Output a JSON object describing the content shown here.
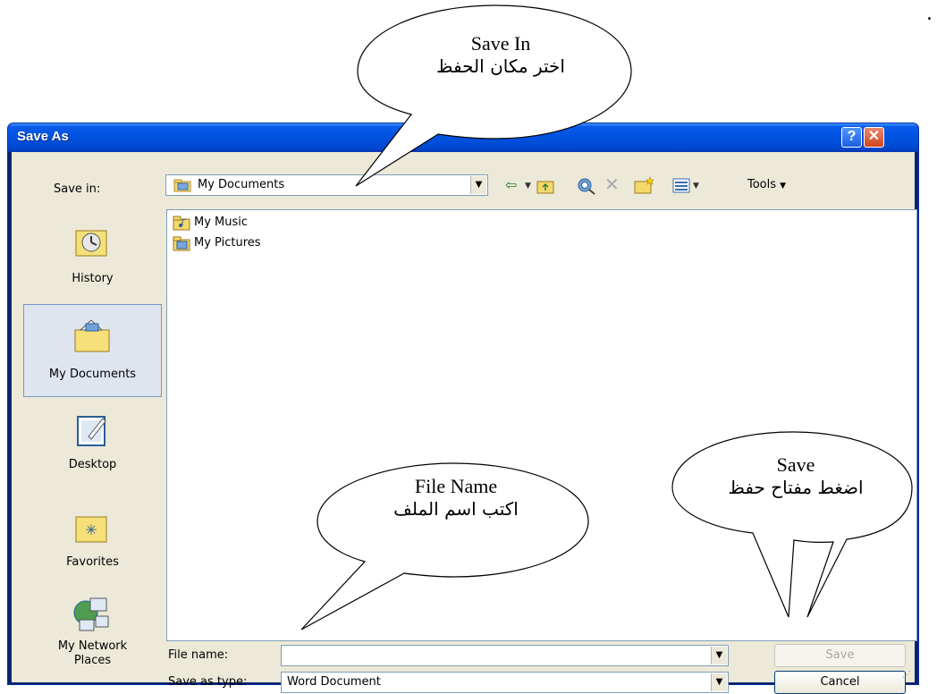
{
  "dialog": {
    "title": "Save As",
    "help_label": "?",
    "close_label": "✕"
  },
  "toolbar": {
    "save_in_label": "Save in:",
    "save_in_value": "My Documents",
    "tools_label": "Tools"
  },
  "places": [
    {
      "label": "History",
      "icon": "history-icon"
    },
    {
      "label": "My Documents",
      "icon": "my-documents-icon",
      "selected": true
    },
    {
      "label": "Desktop",
      "icon": "desktop-icon"
    },
    {
      "label": "Favorites",
      "icon": "favorites-icon"
    },
    {
      "label_line1": "My Network",
      "label_line2": "Places",
      "icon": "network-places-icon"
    }
  ],
  "files": [
    {
      "name": "My Music",
      "icon": "music-folder-icon"
    },
    {
      "name": "My Pictures",
      "icon": "pictures-folder-icon"
    }
  ],
  "fields": {
    "file_name_label": "File name:",
    "file_name_value": "",
    "save_type_label": "Save as type:",
    "save_type_value": "Word Document"
  },
  "buttons": {
    "save_label": "Save",
    "cancel_label": "Cancel"
  },
  "callouts": {
    "save_in": {
      "en": "Save In",
      "ar": "اختر مكان الحفظ"
    },
    "file_name": {
      "en": "File Name",
      "ar": "اكتب اسم الملف"
    },
    "save": {
      "en": "Save",
      "ar": "اضغط مفتاح حفظ"
    }
  },
  "colors": {
    "titlebar": "#0054e3",
    "dialog_bg": "#ece9d8",
    "close_button": "#d2441b"
  }
}
